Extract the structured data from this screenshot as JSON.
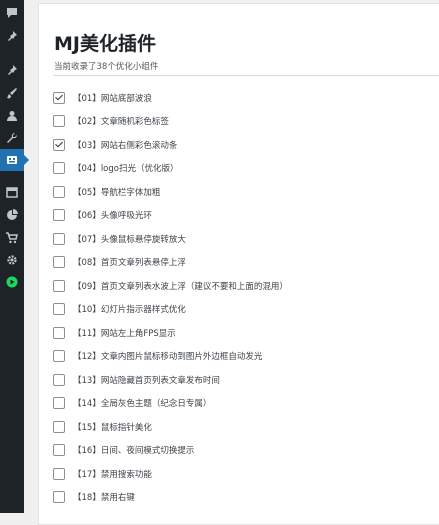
{
  "page": {
    "title": "MJ美化插件",
    "subtitle": "当前收录了38个优化小组件"
  },
  "colors": {
    "sidebar_bg": "#1d2327",
    "sidebar_active": "#2271b1",
    "text": "#3c434a"
  },
  "sidebar": [
    {
      "icon": "comment-icon",
      "active": false
    },
    {
      "icon": "pushpin-icon",
      "active": false
    },
    {
      "icon": "pushpin-icon",
      "active": false
    },
    {
      "icon": "brush-icon",
      "active": false
    },
    {
      "icon": "user-icon",
      "active": false
    },
    {
      "icon": "wrench-icon",
      "active": false
    },
    {
      "icon": "plugin-icon",
      "active": true
    },
    {
      "icon": "calendar-icon",
      "active": false
    },
    {
      "icon": "chart-pie-icon",
      "active": false
    },
    {
      "icon": "cart-icon",
      "active": false
    },
    {
      "icon": "gear-icon",
      "active": false
    },
    {
      "icon": "play-icon",
      "active": false
    }
  ],
  "items": [
    {
      "label": "【01】网站底部波浪",
      "checked": true
    },
    {
      "label": "【02】文章随机彩色标签",
      "checked": false
    },
    {
      "label": "【03】网站右侧彩色滚动条",
      "checked": true
    },
    {
      "label": "【04】logo扫光（优化版）",
      "checked": false
    },
    {
      "label": "【05】导航栏字体加粗",
      "checked": false
    },
    {
      "label": "【06】头像呼吸光环",
      "checked": false
    },
    {
      "label": "【07】头像鼠标悬停旋转放大",
      "checked": false
    },
    {
      "label": "【08】首页文章列表悬停上浮",
      "checked": false
    },
    {
      "label": "【09】首页文章列表水波上浮（建议不要和上面的混用）",
      "checked": false
    },
    {
      "label": "【10】幻灯片指示器样式优化",
      "checked": false
    },
    {
      "label": "【11】网站左上角FPS显示",
      "checked": false
    },
    {
      "label": "【12】文章内图片鼠标移动到图片外边框自动发光",
      "checked": false
    },
    {
      "label": "【13】网站隐藏首页列表文章发布时间",
      "checked": false
    },
    {
      "label": "【14】全局灰色主题（纪念日专属）",
      "checked": false
    },
    {
      "label": "【15】鼠标指针美化",
      "checked": false
    },
    {
      "label": "【16】日间、夜间模式切换提示",
      "checked": false
    },
    {
      "label": "【17】禁用搜索功能",
      "checked": false
    },
    {
      "label": "【18】禁用右键",
      "checked": false
    }
  ]
}
